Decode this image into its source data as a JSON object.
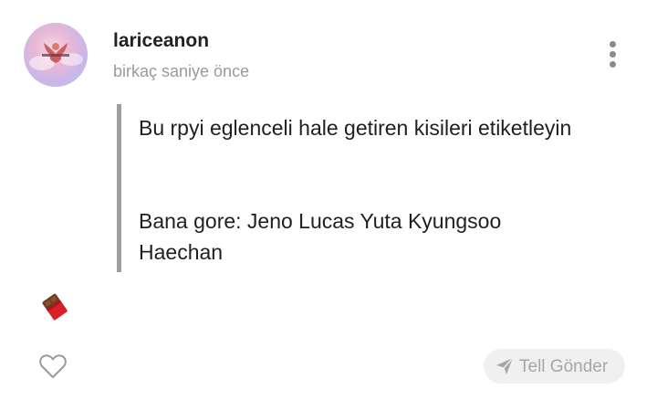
{
  "post": {
    "username": "lariceanon",
    "timestamp": "birkaç saniye önce",
    "quote_paragraph_1": "Bu rpyi eglenceli hale getiren kisileri etiketleyin",
    "quote_paragraph_2": "Bana gore: Jeno Lucas Yuta Kyungsoo Haechan"
  },
  "actions": {
    "more_icon": "more-vertical-icon",
    "like_icon": "heart-outline-icon",
    "tip_icon": "paper-plane-icon",
    "tip_label": "Tell Gönder"
  },
  "sticker": {
    "icon": "chocolate-bar-icon"
  },
  "colors": {
    "text": "#222222",
    "muted": "#9a9a9a",
    "quote_bar": "#9e9e9e",
    "tip_bg": "#f0f0f0",
    "tip_text": "#a6a6a6"
  }
}
